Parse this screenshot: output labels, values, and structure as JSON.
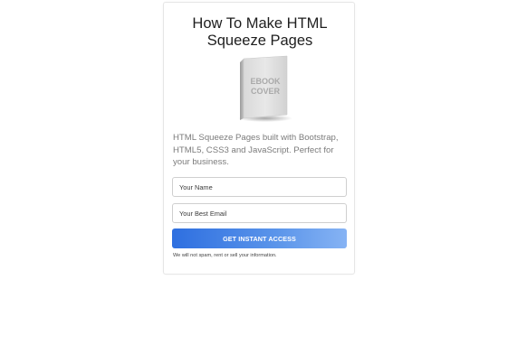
{
  "card": {
    "title_line1": "How To Make HTML",
    "title_line2": "Squeeze Pages",
    "ebook": {
      "label_line1": "EBOOK",
      "label_line2": "COVER"
    },
    "description": "HTML Squeeze Pages built with Bootstrap, HTML5, CSS3 and JavaScript. Perfect for your business.",
    "form": {
      "name_placeholder": "Your Name",
      "email_placeholder": "Your Best Email",
      "submit_label": "GET INSTANT ACCESS"
    },
    "disclaimer": "We will not spam, rent or sell your information."
  },
  "colors": {
    "button_start": "#2e6fe0",
    "button_end": "#86b3f4",
    "text_muted": "#7b7b7b",
    "title": "#1e1e1e"
  }
}
